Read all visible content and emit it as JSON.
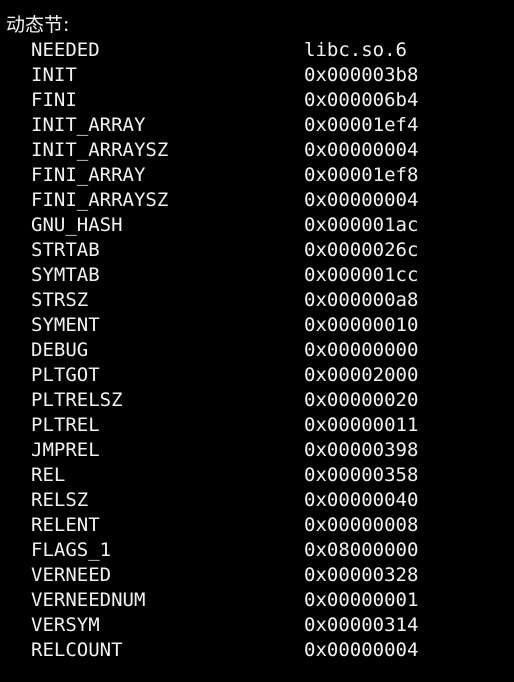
{
  "terminal": {
    "header": "动态节:",
    "entries": [
      {
        "tag": "NEEDED",
        "value": "libc.so.6"
      },
      {
        "tag": "INIT",
        "value": "0x000003b8"
      },
      {
        "tag": "FINI",
        "value": "0x000006b4"
      },
      {
        "tag": "INIT_ARRAY",
        "value": "0x00001ef4"
      },
      {
        "tag": "INIT_ARRAYSZ",
        "value": "0x00000004"
      },
      {
        "tag": "FINI_ARRAY",
        "value": "0x00001ef8"
      },
      {
        "tag": "FINI_ARRAYSZ",
        "value": "0x00000004"
      },
      {
        "tag": "GNU_HASH",
        "value": "0x000001ac"
      },
      {
        "tag": "STRTAB",
        "value": "0x0000026c"
      },
      {
        "tag": "SYMTAB",
        "value": "0x000001cc"
      },
      {
        "tag": "STRSZ",
        "value": "0x000000a8"
      },
      {
        "tag": "SYMENT",
        "value": "0x00000010"
      },
      {
        "tag": "DEBUG",
        "value": "0x00000000"
      },
      {
        "tag": "PLTGOT",
        "value": "0x00002000"
      },
      {
        "tag": "PLTRELSZ",
        "value": "0x00000020"
      },
      {
        "tag": "PLTREL",
        "value": "0x00000011"
      },
      {
        "tag": "JMPREL",
        "value": "0x00000398"
      },
      {
        "tag": "REL",
        "value": "0x00000358"
      },
      {
        "tag": "RELSZ",
        "value": "0x00000040"
      },
      {
        "tag": "RELENT",
        "value": "0x00000008"
      },
      {
        "tag": "FLAGS_1",
        "value": "0x08000000"
      },
      {
        "tag": "VERNEED",
        "value": "0x00000328"
      },
      {
        "tag": "VERNEEDNUM",
        "value": "0x00000001"
      },
      {
        "tag": "VERSYM",
        "value": "0x00000314"
      },
      {
        "tag": "RELCOUNT",
        "value": "0x00000004"
      }
    ]
  },
  "colors": {
    "background": "#000000",
    "text": "#f2f2f2"
  }
}
